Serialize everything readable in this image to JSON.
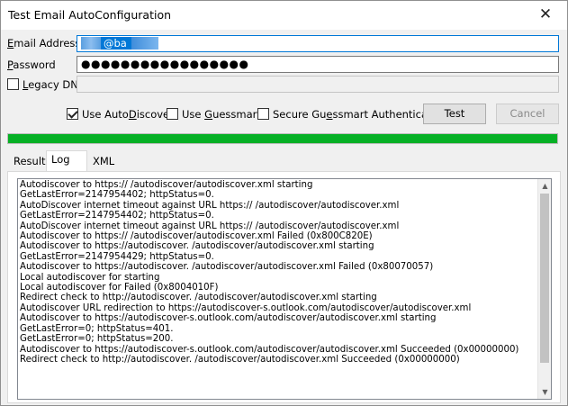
{
  "window": {
    "title": "Test Email AutoConfiguration",
    "close_glyph": "✕"
  },
  "form": {
    "email_label": "Email Address",
    "email_value": "@ba",
    "password_label": "Password",
    "password_value": "●●●●●●●●●●●●●●●●●",
    "legacy_dn_label": "Legacy DN",
    "legacy_dn_value": ""
  },
  "options": {
    "use_autodiscover": {
      "label": "Use AutoDiscover",
      "checked": true
    },
    "use_guessmart": {
      "label": "Use Guessmart",
      "checked": false
    },
    "secure_guessmart": {
      "label": "Secure Guessmart Authentication",
      "checked": false
    }
  },
  "buttons": {
    "test": "Test",
    "cancel": "Cancel"
  },
  "progress": {
    "percent": 100,
    "color": "#06b025"
  },
  "tabs": [
    "Results",
    "Log",
    "XML"
  ],
  "active_tab": "Log",
  "log": [
    "Autodiscover to https://                  /autodiscover/autodiscover.xml starting",
    "GetLastError=2147954402; httpStatus=0.",
    "AutoDiscover internet timeout against URL https://             /autodiscover/autodiscover.xml",
    "GetLastError=2147954402; httpStatus=0.",
    "AutoDiscover internet timeout against URL https://             /autodiscover/autodiscover.xml",
    "Autodiscover to https://             /autodiscover/autodiscover.xml Failed (0x800C820E)",
    "Autodiscover to https://autodiscover.                /autodiscover/autodiscover.xml starting",
    "GetLastError=2147954429; httpStatus=0.",
    "Autodiscover to https://autodiscover.                /autodiscover/autodiscover.xml Failed (0x80070057)",
    "Local autodiscover for                starting",
    "Local autodiscover for                Failed (0x8004010F)",
    "Redirect check to http://autodiscover.                /autodiscover/autodiscover.xml starting",
    "Autodiscover URL redirection to https://autodiscover-s.outlook.com/autodiscover/autodiscover.xml",
    "Autodiscover to https://autodiscover-s.outlook.com/autodiscover/autodiscover.xml starting",
    "GetLastError=0; httpStatus=401.",
    "GetLastError=0; httpStatus=200.",
    "Autodiscover to https://autodiscover-s.outlook.com/autodiscover/autodiscover.xml Succeeded (0x00000000)",
    "Redirect check to http://autodiscover.                /autodiscover/autodiscover.xml Succeeded (0x00000000)"
  ],
  "scroll": {
    "up_glyph": "▲",
    "down_glyph": "▼"
  }
}
